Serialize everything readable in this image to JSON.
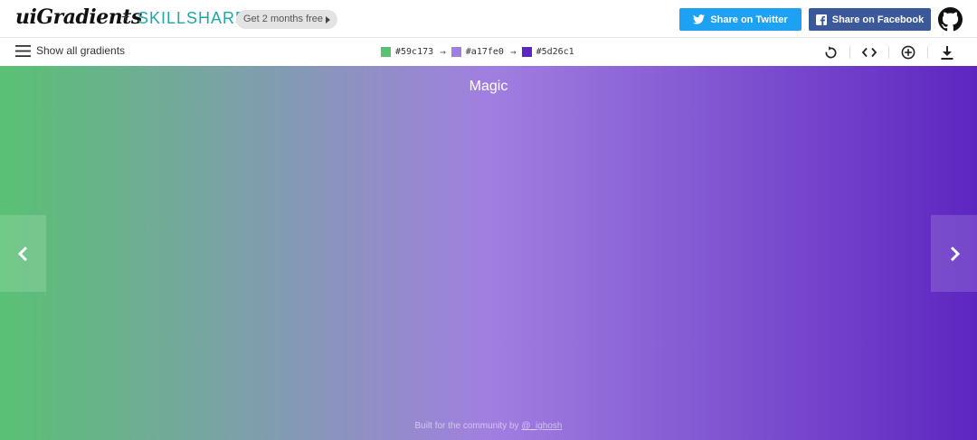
{
  "header": {
    "logo": "uiGradients",
    "plus": "+",
    "partner": "SKILLSHARE",
    "promo_label": "Get 2 months free",
    "share_twitter_label": "Share on Twitter",
    "share_facebook_label": "Share on Facebook"
  },
  "toolbar": {
    "menu_label": "Show all gradients",
    "arrow": "→",
    "colors": [
      {
        "hex": "#59c173",
        "label": "#59c173"
      },
      {
        "hex": "#a17fe0",
        "label": "#a17fe0"
      },
      {
        "hex": "#5d26c1",
        "label": "#5d26c1"
      }
    ],
    "icons": [
      "rotate-icon",
      "code-icon",
      "add-icon",
      "download-icon"
    ]
  },
  "gradient": {
    "name": "Magic",
    "stops": [
      "#59c173",
      "#a17fe0",
      "#5d26c1"
    ],
    "direction": "to right"
  },
  "footer": {
    "prefix": "Built for the community by",
    "handle": "@_ighosh"
  },
  "brand_colors": {
    "twitter": "#1da1f2",
    "facebook": "#3b5998",
    "skillshare": "#22a5a8"
  }
}
